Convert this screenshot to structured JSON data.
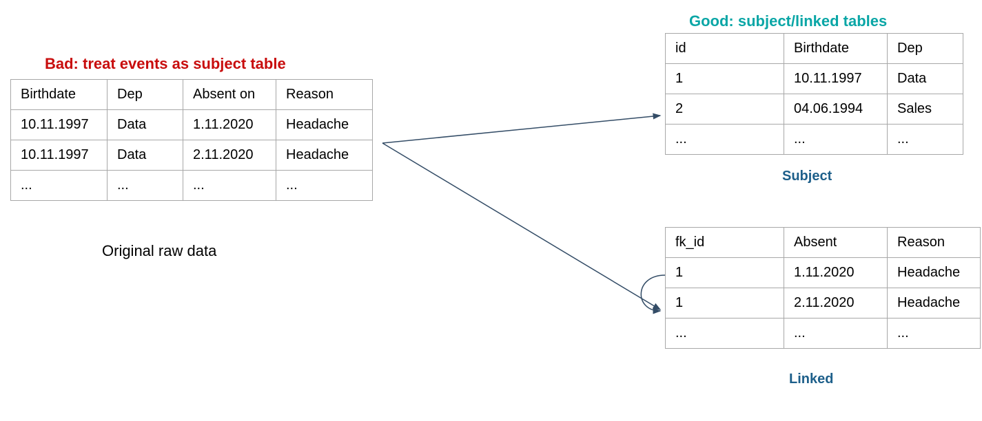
{
  "titles": {
    "bad": "Bad: treat events as subject table",
    "good": "Good: subject/linked tables"
  },
  "colors": {
    "bad": "#c80d0d",
    "good": "#0aa6a6",
    "label": "#1d5f8a",
    "arrow": "#334c66"
  },
  "captions": {
    "left": "Original raw data",
    "subject": "Subject",
    "linked": "Linked"
  },
  "leftTable": {
    "headers": [
      "Birthdate",
      "Dep",
      "Absent on",
      "Reason"
    ],
    "rows": [
      [
        "10.11.1997",
        "Data",
        "1.11.2020",
        "Headache"
      ],
      [
        "10.11.1997",
        "Data",
        "2.11.2020",
        "Headache"
      ],
      [
        "...",
        "...",
        "...",
        "..."
      ]
    ]
  },
  "subjectTable": {
    "headers": [
      "id",
      "Birthdate",
      "Dep"
    ],
    "rows": [
      [
        "1",
        "10.11.1997",
        "Data"
      ],
      [
        "2",
        "04.06.1994",
        "Sales"
      ],
      [
        "...",
        "...",
        "..."
      ]
    ]
  },
  "linkedTable": {
    "headers": [
      "fk_id",
      "Absent",
      "Reason"
    ],
    "rows": [
      [
        "1",
        "1.11.2020",
        "Headache"
      ],
      [
        "1",
        "2.11.2020",
        "Headache"
      ],
      [
        "...",
        "...",
        "..."
      ]
    ]
  }
}
